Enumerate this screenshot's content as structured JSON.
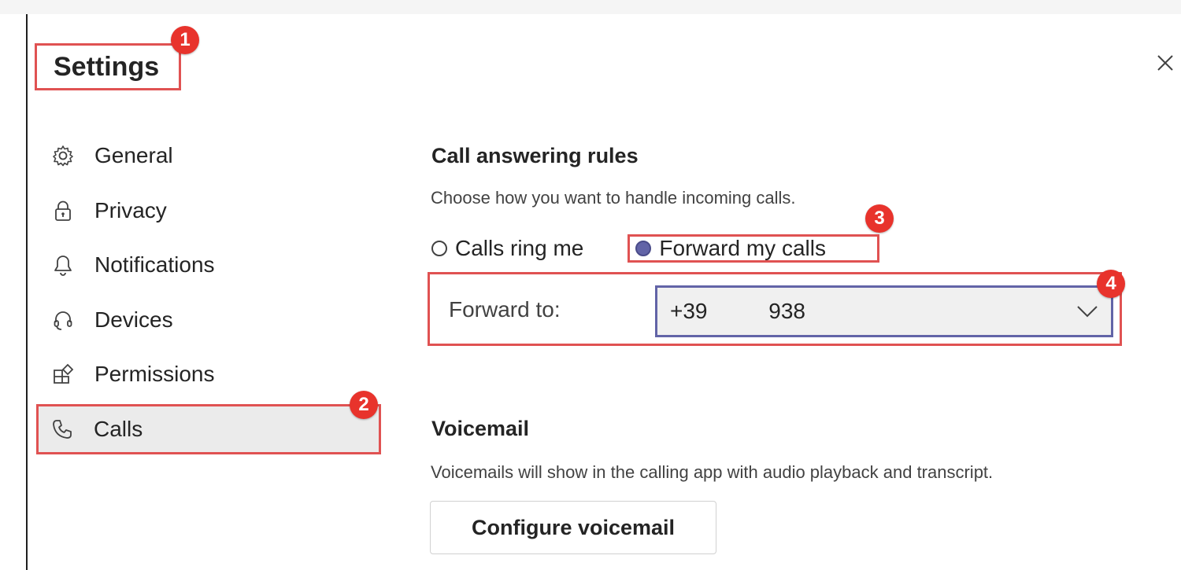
{
  "dialog": {
    "title": "Settings",
    "close_icon": "close-icon"
  },
  "sidebar": {
    "items": [
      {
        "label": "General",
        "icon": "gear-icon",
        "selected": false
      },
      {
        "label": "Privacy",
        "icon": "lock-icon",
        "selected": false
      },
      {
        "label": "Notifications",
        "icon": "bell-icon",
        "selected": false
      },
      {
        "label": "Devices",
        "icon": "headset-icon",
        "selected": false
      },
      {
        "label": "Permissions",
        "icon": "apps-icon",
        "selected": false
      },
      {
        "label": "Calls",
        "icon": "phone-icon",
        "selected": true
      }
    ]
  },
  "call_answering": {
    "heading": "Call answering rules",
    "description": "Choose how you want to handle incoming calls.",
    "options": [
      {
        "label": "Calls ring me",
        "selected": false
      },
      {
        "label": "Forward my calls",
        "selected": true
      }
    ],
    "forward_label": "Forward to:",
    "forward_value": "+39          938"
  },
  "voicemail": {
    "heading": "Voicemail",
    "description": "Voicemails will show in the calling app with audio playback and transcript.",
    "button_label": "Configure voicemail"
  },
  "annotations": [
    "1",
    "2",
    "3",
    "4"
  ],
  "colors": {
    "accent": "#6264a7",
    "annotation_red": "#e8332c",
    "highlight_border": "#e05252"
  }
}
